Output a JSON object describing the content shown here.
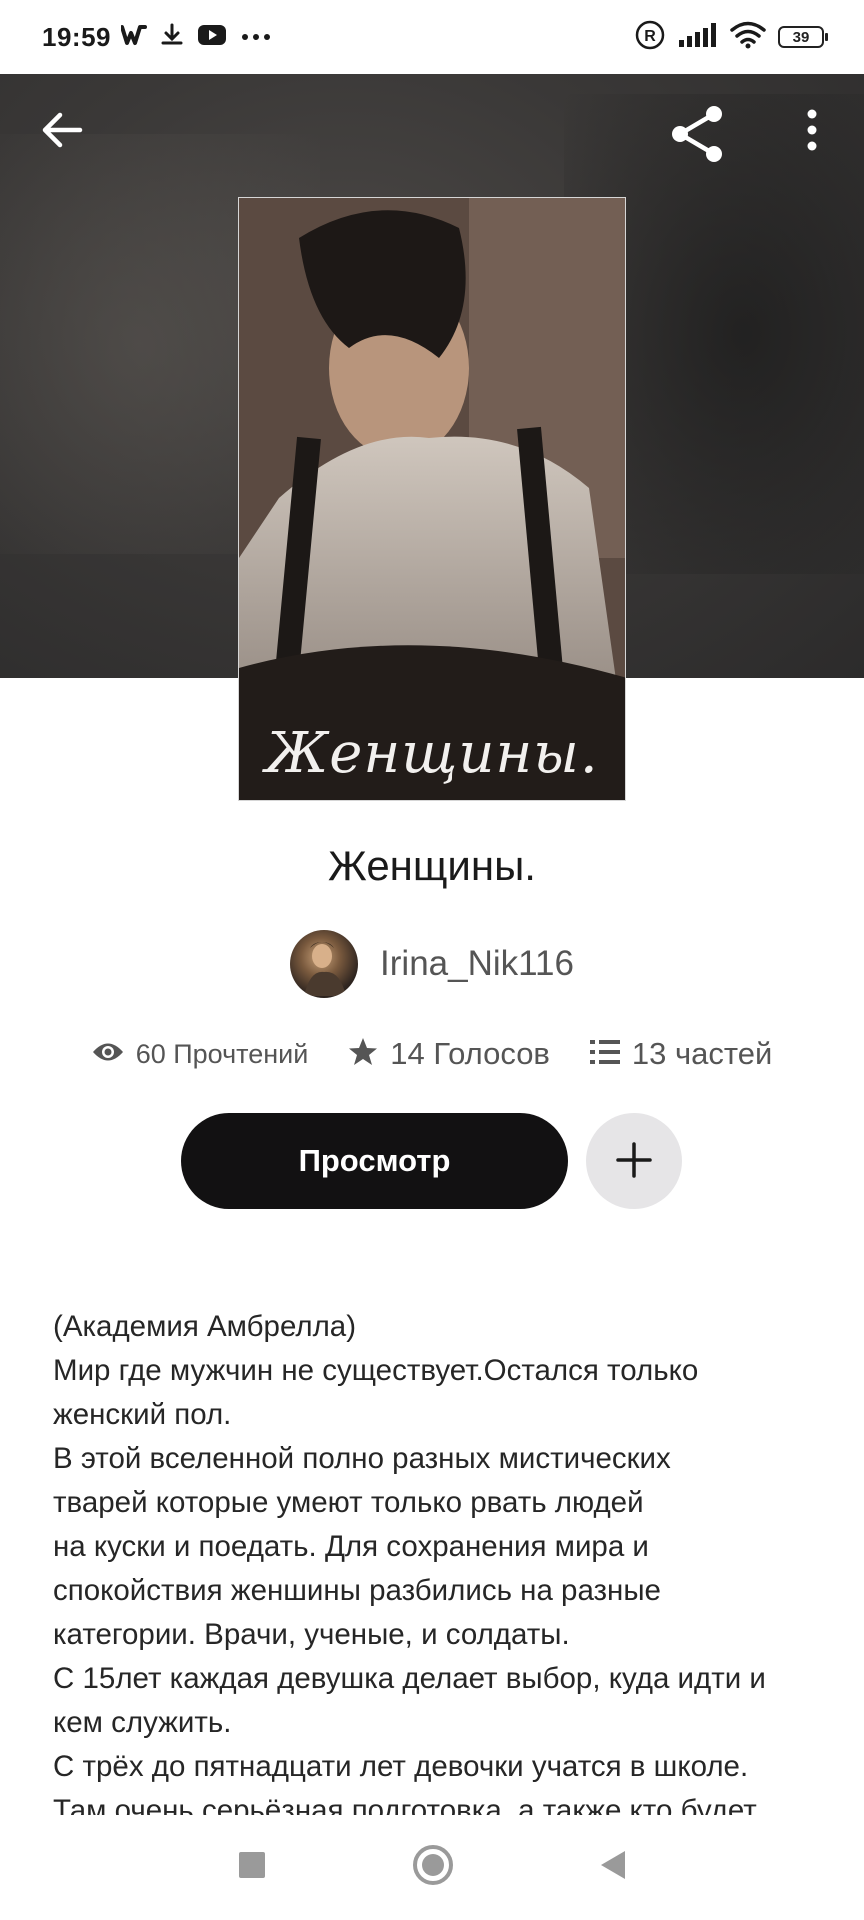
{
  "status_bar": {
    "time": "19:59",
    "left_icons": [
      "wattpad-w-icon",
      "download-icon",
      "youtube-icon",
      "more-dots-icon"
    ],
    "right_icons": [
      "registered-icon",
      "signal-icon",
      "wifi-icon"
    ],
    "battery": "39"
  },
  "header": {
    "back_icon": "arrow-left-icon",
    "share_icon": "share-icon",
    "more_icon": "more-vertical-icon"
  },
  "cover": {
    "title": "Женщины."
  },
  "story": {
    "title": "Женщины.",
    "author": "Irina_Nik116",
    "stats": {
      "reads": "60 Прочтений",
      "votes": "14 Голосов",
      "parts": "13 частей"
    },
    "read_button": "Просмотр",
    "add_button_icon": "plus-icon",
    "description_lines": [
      "(Академия Амбрелла)",
      "Мир где мужчин не существует.Остался только",
      "женский пол.",
      "В этой вселенной полно разных мистических",
      "тварей которые умеют только рвать людей",
      "на куски и поедать. Для сохранения мира и",
      "спокойствия женшины разбились на разные",
      "категории. Врачи, ученые, и солдаты.",
      "С 15лет каждая девушка делает выбор, куда идти и",
      "кем служить.",
      "С трёх до пятнадцати лет девочки учатся в школе.",
      "Там очень серьёзная подготовка, а также кто будет"
    ]
  },
  "nav_bar": {
    "icons": [
      "recent-apps-icon",
      "home-icon",
      "back-triangle-icon"
    ]
  },
  "colors": {
    "button_dark": "#121112",
    "button_light": "#e6e5e7",
    "text_secondary": "#555555"
  }
}
